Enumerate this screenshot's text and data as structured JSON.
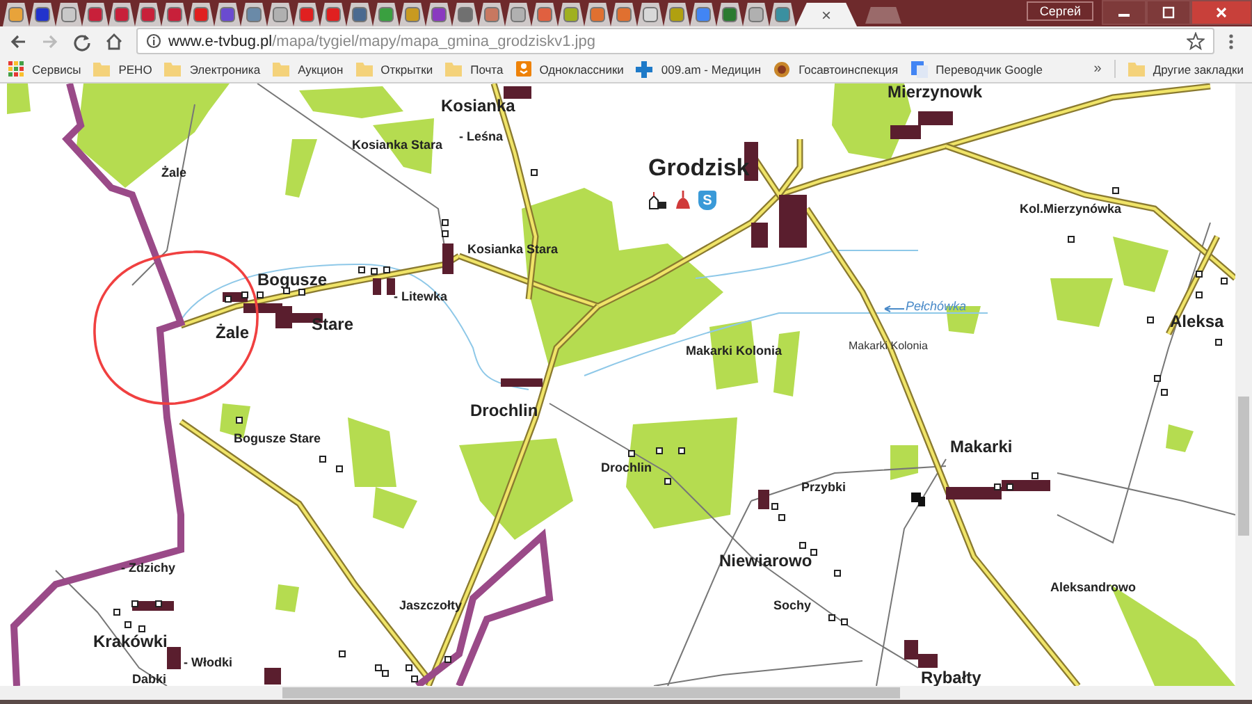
{
  "browser": {
    "tabs": [
      {
        "selected": false,
        "color": "#e8a33a"
      },
      {
        "selected": false,
        "color": "#2233cc"
      },
      {
        "selected": false,
        "color": "#c8c8c8"
      },
      {
        "selected": false,
        "color": "#c8203a"
      },
      {
        "selected": false,
        "color": "#c8203a"
      },
      {
        "selected": false,
        "color": "#c8203a"
      },
      {
        "selected": false,
        "color": "#c8203a"
      },
      {
        "selected": false,
        "color": "#e02020"
      },
      {
        "selected": false,
        "color": "#6a4bd0"
      },
      {
        "selected": false,
        "color": "#6a8aa8"
      },
      {
        "selected": false,
        "color": "#b0b0b0"
      },
      {
        "selected": false,
        "color": "#e02020"
      },
      {
        "selected": false,
        "color": "#e02020"
      },
      {
        "selected": false,
        "color": "#4a6a90"
      },
      {
        "selected": false,
        "color": "#3aa040"
      },
      {
        "selected": false,
        "color": "#c89a20"
      },
      {
        "selected": false,
        "color": "#8a3ac0"
      },
      {
        "selected": false,
        "color": "#707070"
      },
      {
        "selected": false,
        "color": "#c87860"
      },
      {
        "selected": false,
        "color": "#b0b0b0"
      },
      {
        "selected": false,
        "color": "#e06040"
      },
      {
        "selected": false,
        "color": "#a0b020"
      },
      {
        "selected": false,
        "color": "#e07030"
      },
      {
        "selected": false,
        "color": "#e07030"
      },
      {
        "selected": false,
        "color": "#d8d8d8"
      },
      {
        "selected": false,
        "color": "#b0a010"
      },
      {
        "selected": false,
        "color": "#4285f4"
      },
      {
        "selected": false,
        "color": "#2a7a30"
      },
      {
        "selected": false,
        "color": "#b0b0b0"
      },
      {
        "selected": false,
        "color": "#3a90a0"
      },
      {
        "selected": true,
        "close": "×"
      }
    ],
    "profile_name": "Сергей",
    "url": {
      "domain": "www.e-tvbug.pl",
      "path": "/mapa/tygiel/mapy/mapa_gmina_grodziskv1.jpg"
    },
    "bookmarks": [
      {
        "label": "Сервисы",
        "kind": "apps"
      },
      {
        "label": "РЕНО",
        "kind": "folder"
      },
      {
        "label": "Электроника",
        "kind": "folder"
      },
      {
        "label": "Аукцион",
        "kind": "folder"
      },
      {
        "label": "Открытки",
        "kind": "folder"
      },
      {
        "label": "Почта",
        "kind": "folder"
      },
      {
        "label": "Одноклассники",
        "kind": "social"
      },
      {
        "label": "009.am - Медицин",
        "kind": "medical"
      },
      {
        "label": "Госавтоинспекция",
        "kind": "emblem"
      },
      {
        "label": "Переводчик Google",
        "kind": "translate"
      }
    ],
    "overflow": "»",
    "other_bookmarks": "Другие закладки"
  },
  "map": {
    "badge": "S",
    "labels": [
      {
        "text": "Kosianka",
        "kind": "town"
      },
      {
        "text": "- Leśna",
        "kind": "small"
      },
      {
        "text": "Kosianka Stara",
        "kind": "small"
      },
      {
        "text": "Żale",
        "kind": "small"
      },
      {
        "text": "Kosianka Stara",
        "kind": "small"
      },
      {
        "text": "Bogusze",
        "kind": "town"
      },
      {
        "text": "- Litewka",
        "kind": "small"
      },
      {
        "text": "Żale",
        "kind": "town"
      },
      {
        "text": "Stare",
        "kind": "town"
      },
      {
        "text": "Drochlin",
        "kind": "town"
      },
      {
        "text": "Grodzisk",
        "kind": "city"
      },
      {
        "text": "Mierzynowk",
        "kind": "town"
      },
      {
        "text": "Kol.Mierzynówka",
        "kind": "small"
      },
      {
        "text": "Pełchówka",
        "kind": "river"
      },
      {
        "text": "Makarki Kolonia",
        "kind": "small"
      },
      {
        "text": "Makarki Kolonia",
        "kind": "tiny"
      },
      {
        "text": "Aleksa",
        "kind": "town"
      },
      {
        "text": "Bogusze Stare",
        "kind": "small"
      },
      {
        "text": "Drochlin",
        "kind": "small"
      },
      {
        "text": "Przybki",
        "kind": "small"
      },
      {
        "text": "Makarki",
        "kind": "town"
      },
      {
        "text": "Niewiarowo",
        "kind": "town"
      },
      {
        "text": "Aleksandrowo",
        "kind": "small"
      },
      {
        "text": "- Zdzichy",
        "kind": "small"
      },
      {
        "text": "Jaszczołty",
        "kind": "small"
      },
      {
        "text": "Krakówki",
        "kind": "town"
      },
      {
        "text": "- Włodki",
        "kind": "small"
      },
      {
        "text": "Dabki",
        "kind": "small"
      },
      {
        "text": "Sochy",
        "kind": "small"
      },
      {
        "text": "Rybałty",
        "kind": "town"
      }
    ]
  }
}
